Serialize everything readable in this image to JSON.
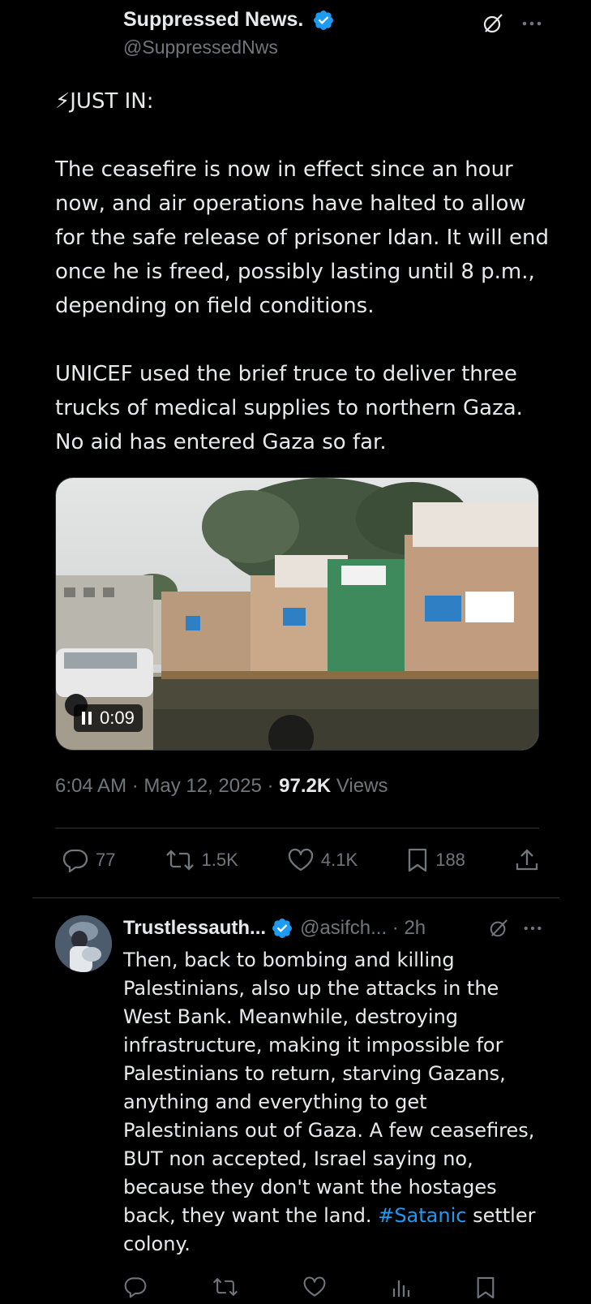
{
  "tweet": {
    "author_name": "Suppressed News.",
    "author_handle": "@SuppressedNws",
    "text": "⚡JUST IN:\n\nThe ceasefire is now in effect since an hour now, and air operations have halted to allow for the safe release of prisoner Idan. It will end once he is freed, possibly lasting until 8 p.m., depending on field conditions.\n\nUNICEF used the brief truce to deliver three trucks of medical supplies to northern Gaza. No aid has entered Gaza so far.",
    "video_time": "0:09",
    "timestamp": "6:04 AM · May 12, 2025 · ",
    "views_count": "97.2K",
    "views_label": " Views",
    "replies": "77",
    "reposts": "1.5K",
    "likes": "4.1K",
    "bookmarks": "188"
  },
  "reply": {
    "author_name": "Trustlessauth...",
    "author_handle": "@asifch... · 2h",
    "text_before": "Then, back to bombing and killing Palestinians, also up the attacks in the West Bank. Meanwhile, destroying infrastructure, making it impossible for Palestinians to return, starving Gazans, anything and everything to get Palestinians out of Gaza. A few ceasefires, BUT non accepted, Israel saying no, because they don't want the hostages back, they want the land. ",
    "hashtag": "#Satanic",
    "text_after": " settler colony."
  },
  "colors": {
    "background": "#000000",
    "text": "#e7e9ea",
    "muted": "#71767b",
    "accent": "#1d9bf0",
    "divider": "#2f3336"
  },
  "icons": [
    "verified-badge-icon",
    "grok-icon",
    "more-icon",
    "reply-icon",
    "repost-icon",
    "like-icon",
    "bookmark-icon",
    "share-icon",
    "views-icon",
    "pause-icon"
  ]
}
